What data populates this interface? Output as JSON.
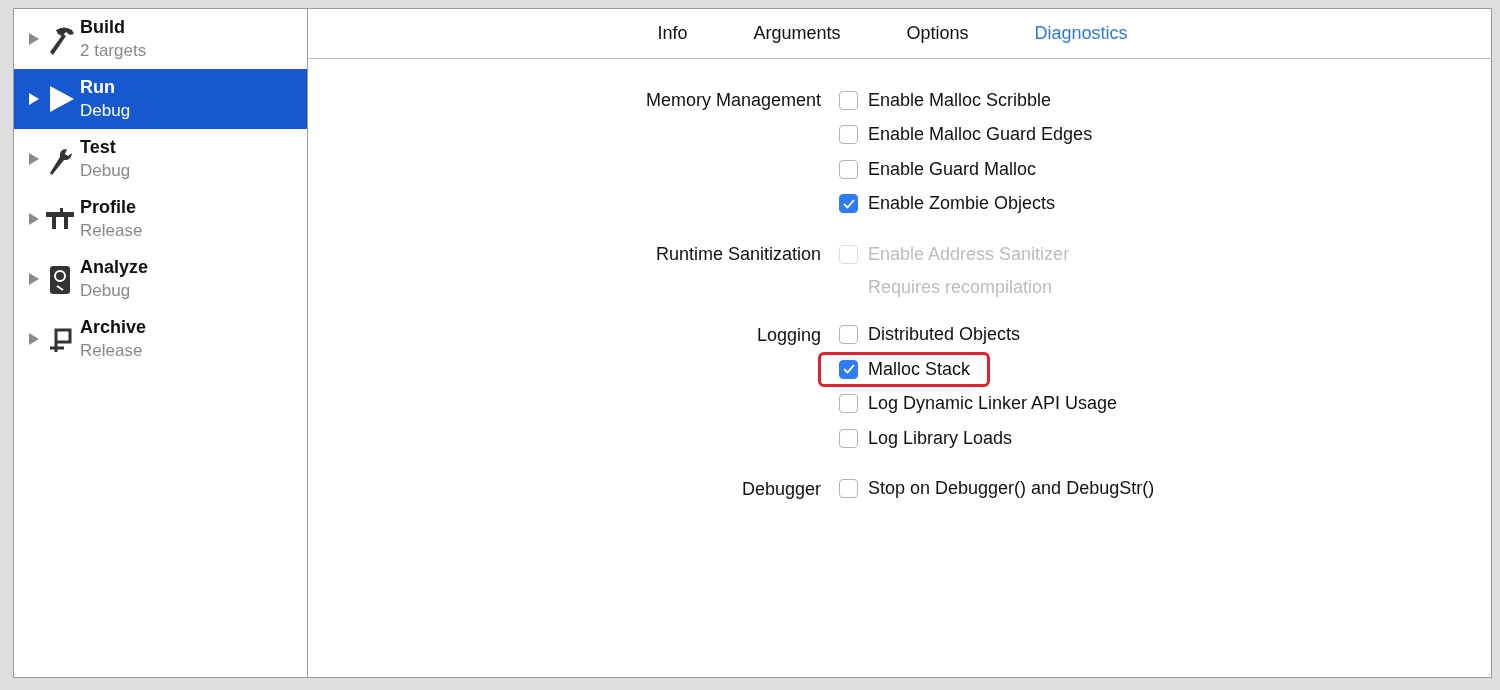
{
  "sidebar": {
    "items": [
      {
        "title": "Build",
        "subtitle": "2 targets",
        "selected": false
      },
      {
        "title": "Run",
        "subtitle": "Debug",
        "selected": true
      },
      {
        "title": "Test",
        "subtitle": "Debug",
        "selected": false
      },
      {
        "title": "Profile",
        "subtitle": "Release",
        "selected": false
      },
      {
        "title": "Analyze",
        "subtitle": "Debug",
        "selected": false
      },
      {
        "title": "Archive",
        "subtitle": "Release",
        "selected": false
      }
    ]
  },
  "tabs": [
    {
      "label": "Info",
      "selected": false
    },
    {
      "label": "Arguments",
      "selected": false
    },
    {
      "label": "Options",
      "selected": false
    },
    {
      "label": "Diagnostics",
      "selected": true
    }
  ],
  "sections": [
    {
      "label": "Memory Management",
      "options": [
        {
          "label": "Enable Malloc Scribble",
          "checked": false,
          "disabled": false,
          "highlighted": false
        },
        {
          "label": "Enable Malloc Guard Edges",
          "checked": false,
          "disabled": false,
          "highlighted": false
        },
        {
          "label": "Enable Guard Malloc",
          "checked": false,
          "disabled": false,
          "highlighted": false
        },
        {
          "label": "Enable Zombie Objects",
          "checked": true,
          "disabled": false,
          "highlighted": false
        }
      ]
    },
    {
      "label": "Runtime Sanitization",
      "options": [
        {
          "label": "Enable Address Sanitizer",
          "checked": false,
          "disabled": true,
          "highlighted": false,
          "note": "Requires recompilation"
        }
      ]
    },
    {
      "label": "Logging",
      "options": [
        {
          "label": "Distributed Objects",
          "checked": false,
          "disabled": false,
          "highlighted": false
        },
        {
          "label": "Malloc Stack",
          "checked": true,
          "disabled": false,
          "highlighted": true
        },
        {
          "label": "Log Dynamic Linker API Usage",
          "checked": false,
          "disabled": false,
          "highlighted": false
        },
        {
          "label": "Log Library Loads",
          "checked": false,
          "disabled": false,
          "highlighted": false
        }
      ]
    },
    {
      "label": "Debugger",
      "options": [
        {
          "label": "Stop on Debugger() and DebugStr()",
          "checked": false,
          "disabled": false,
          "highlighted": false
        }
      ]
    }
  ]
}
